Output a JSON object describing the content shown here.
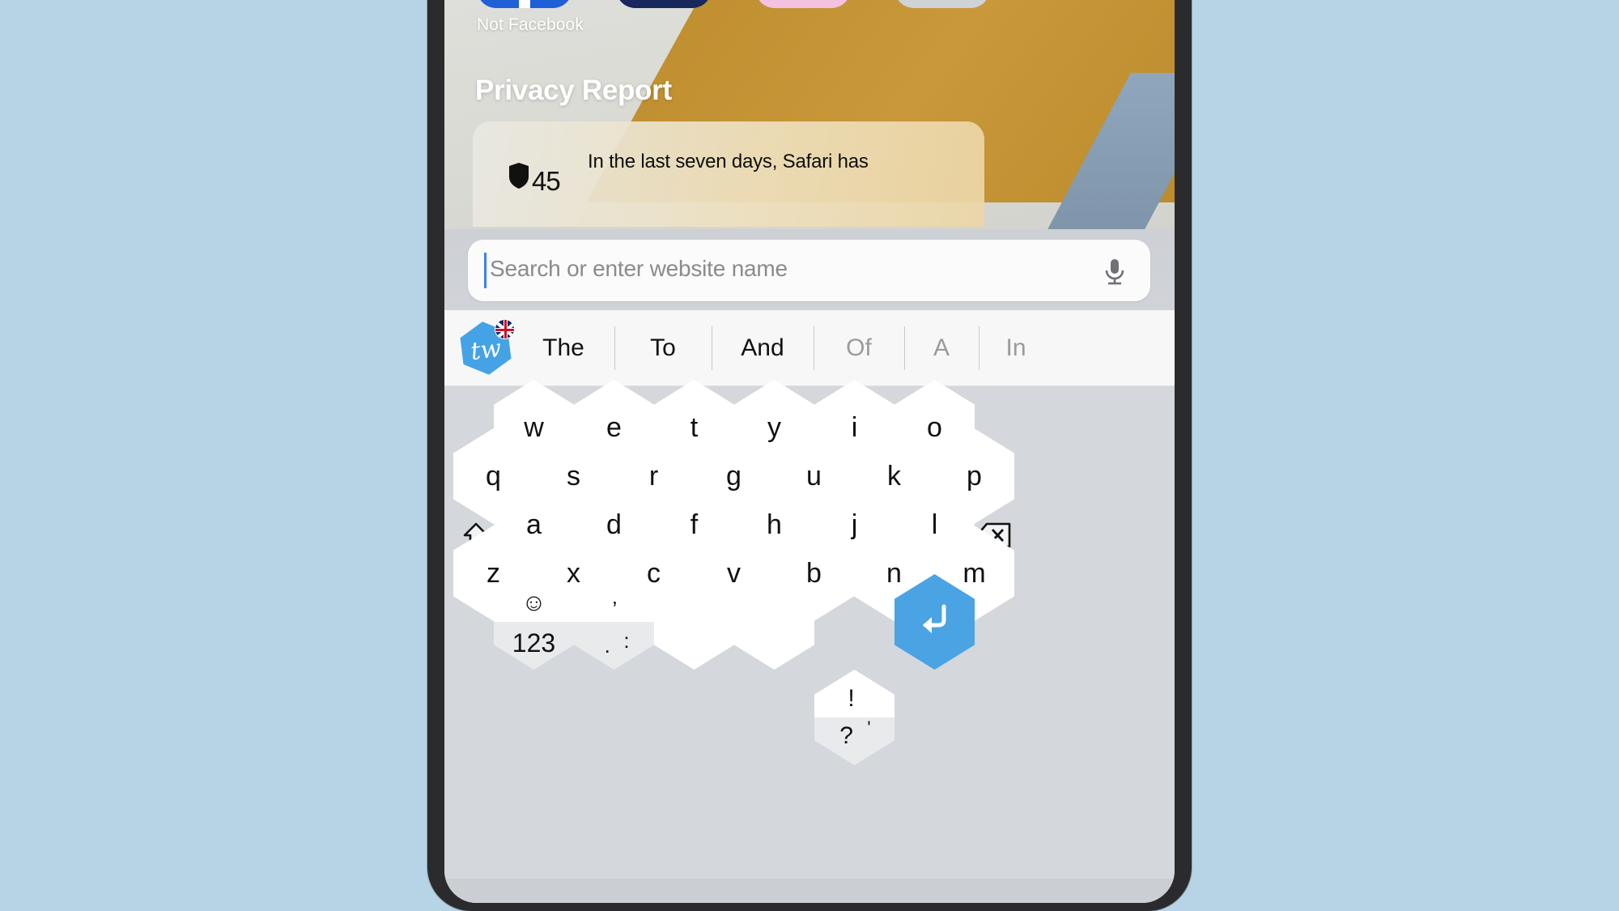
{
  "device": {
    "frame_color": "#2b2b2d",
    "background_color": "#b7d3e6"
  },
  "safari": {
    "app_label": "Not Facebook",
    "page_title": "Privacy Report",
    "privacy_card": {
      "tracker_count": "45",
      "shield_icon": "shield-icon",
      "text": "In the last seven days, Safari has"
    },
    "app_icons": [
      {
        "name": "facebook-app-icon",
        "color": "#1f5fd8"
      },
      {
        "name": "navy-app-icon",
        "color": "#18275c"
      },
      {
        "name": "pink-app-icon",
        "color": "#f4c2e0"
      },
      {
        "name": "grey-app-icon",
        "color": "#cfd2d6"
      }
    ]
  },
  "search": {
    "placeholder": "Search or enter website name",
    "value": "",
    "caret_color": "#3a82f0",
    "mic_icon": "microphone-icon"
  },
  "keyboard": {
    "brand": "Typewise",
    "logo_letters": "tw",
    "language_flag": "uk-flag-icon",
    "accent_color": "#4aa3e3",
    "predictions": [
      {
        "label": "The",
        "dim": false
      },
      {
        "label": "To",
        "dim": false
      },
      {
        "label": "And",
        "dim": false
      },
      {
        "label": "Of",
        "dim": true
      },
      {
        "label": "A",
        "dim": true
      },
      {
        "label": "In",
        "dim": true
      }
    ],
    "rows": {
      "row1": [
        "w",
        "e",
        "t",
        "y",
        "i",
        "o"
      ],
      "row2": [
        "q",
        "s",
        "r",
        "g",
        "u",
        "k",
        "p"
      ],
      "row3": [
        "a",
        "d",
        "f",
        "h",
        "j",
        "l"
      ],
      "row4": [
        "z",
        "x",
        "c",
        "v",
        "b",
        "n",
        "m"
      ]
    },
    "shift_icon": "shift-arrow-icon",
    "backspace_icon": "backspace-icon",
    "return_icon": "return-arrow-icon",
    "numeric_key": {
      "emoji": "☺",
      "label": "123"
    },
    "punctuation_left": {
      "top": "’",
      "bottom_left": ".",
      "bottom_right": ":"
    },
    "punctuation_right": {
      "top": "!",
      "bottom_left": "?",
      "bottom_right": "'"
    }
  }
}
